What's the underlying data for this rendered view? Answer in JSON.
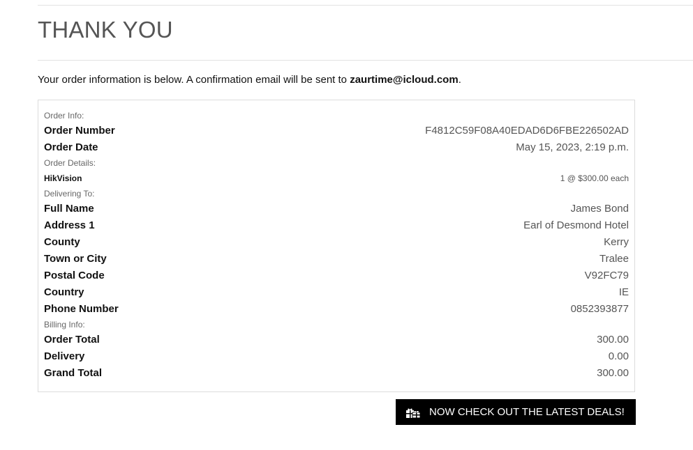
{
  "page": {
    "title": "THANK YOU",
    "intro_prefix": "Your order information is below. A confirmation email will be sent to ",
    "email": "zaurtime@icloud.com",
    "intro_suffix": "."
  },
  "order_info": {
    "label": "Order Info:",
    "number_label": "Order Number",
    "number": "F4812C59F08A40EDAD6D6FBE226502AD",
    "date_label": "Order Date",
    "date": "May 15, 2023, 2:19 p.m."
  },
  "order_details": {
    "label": "Order Details:",
    "items": [
      {
        "name": "HikVision",
        "qty_price": "1 @ $300.00 each"
      }
    ]
  },
  "delivery": {
    "label": "Delivering To:",
    "full_name_label": "Full Name",
    "full_name": "James Bond",
    "address1_label": "Address 1",
    "address1": "Earl of Desmond Hotel",
    "county_label": "County",
    "county": "Kerry",
    "town_label": "Town or City",
    "town": "Tralee",
    "postal_label": "Postal Code",
    "postal": "V92FC79",
    "country_label": "Country",
    "country": "IE",
    "phone_label": "Phone Number",
    "phone": "0852393877"
  },
  "billing": {
    "label": "Billing Info:",
    "order_total_label": "Order Total",
    "order_total": "300.00",
    "delivery_label": "Delivery",
    "delivery": "0.00",
    "grand_total_label": "Grand Total",
    "grand_total": "300.00"
  },
  "cta": {
    "label": "NOW CHECK OUT THE LATEST DEALS!",
    "icon": "gifts-icon"
  }
}
